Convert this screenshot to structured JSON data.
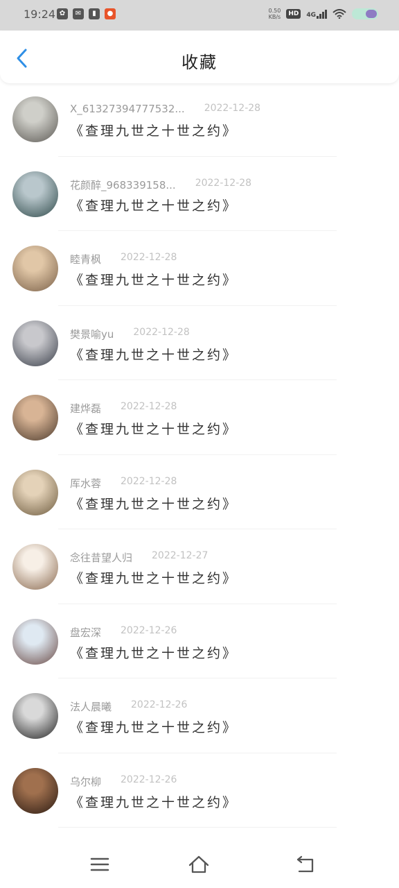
{
  "status_bar": {
    "time": "19:24",
    "net_speed_value": "0.50",
    "net_speed_unit": "KB/s",
    "hd": "HD",
    "network": "4G"
  },
  "header": {
    "title": "收藏"
  },
  "colors": {
    "accent": "#2f8fe6"
  },
  "favorites": [
    {
      "user": "X_61327394777532...",
      "date": "2022-12-28",
      "book": "《查理九世之十世之约》",
      "avatar_colors": [
        "#cfcfc9",
        "#5c5954"
      ]
    },
    {
      "user": "花颜醉_968339158...",
      "date": "2022-12-28",
      "book": "《查理九世之十世之约》",
      "avatar_colors": [
        "#b9c7cc",
        "#2f4a4a"
      ]
    },
    {
      "user": "睦青枫",
      "date": "2022-12-28",
      "book": "《查理九世之十世之约》",
      "avatar_colors": [
        "#e1c7a7",
        "#7a6048"
      ]
    },
    {
      "user": "樊景喻yu",
      "date": "2022-12-28",
      "book": "《查理九世之十世之约》",
      "avatar_colors": [
        "#c8c8cc",
        "#3a3f4a"
      ]
    },
    {
      "user": "建烨磊",
      "date": "2022-12-28",
      "book": "《查理九世之十世之约》",
      "avatar_colors": [
        "#d8b495",
        "#4c3a2c"
      ]
    },
    {
      "user": "厍水蓉",
      "date": "2022-12-28",
      "book": "《查理九世之十世之约》",
      "avatar_colors": [
        "#e4d2b8",
        "#6d5b3f"
      ]
    },
    {
      "user": "念往昔望人归",
      "date": "2022-12-27",
      "book": "《查理九世之十世之约》",
      "avatar_colors": [
        "#f7efe6",
        "#8a6a50"
      ]
    },
    {
      "user": "盘宏深",
      "date": "2022-12-26",
      "book": "《查理九世之十世之约》",
      "avatar_colors": [
        "#dfe9f2",
        "#6a4a45"
      ]
    },
    {
      "user": "法人晨曦",
      "date": "2022-12-26",
      "book": "《查理九世之十世之约》",
      "avatar_colors": [
        "#d9d9d9",
        "#222222"
      ]
    },
    {
      "user": "乌尔柳",
      "date": "2022-12-26",
      "book": "《查理九世之十世之约》",
      "avatar_colors": [
        "#a0704e",
        "#2a1a12"
      ]
    }
  ],
  "nav_bar": {
    "icons": [
      "menu-icon",
      "home-icon",
      "back-icon"
    ]
  }
}
